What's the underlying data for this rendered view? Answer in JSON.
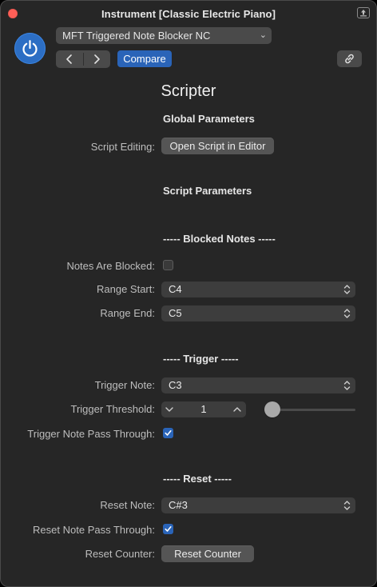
{
  "window": {
    "title": "Instrument [Classic Electric Piano]"
  },
  "header": {
    "preset": "MFT Triggered Note Blocker NC",
    "compare_label": "Compare"
  },
  "plugin": {
    "name": "Scripter"
  },
  "global": {
    "heading": "Global Parameters",
    "script_editing_label": "Script Editing:",
    "open_editor_label": "Open Script in Editor"
  },
  "script_params": {
    "heading": "Script Parameters"
  },
  "blocked": {
    "heading": "----- Blocked Notes -----",
    "notes_blocked_label": "Notes Are Blocked:",
    "notes_blocked_checked": false,
    "range_start_label": "Range Start:",
    "range_start_value": "C4",
    "range_end_label": "Range End:",
    "range_end_value": "C5"
  },
  "trigger": {
    "heading": "----- Trigger -----",
    "note_label": "Trigger Note:",
    "note_value": "C3",
    "threshold_label": "Trigger Threshold:",
    "threshold_value": "1",
    "threshold_slider_fraction": 0.0,
    "pass_through_label": "Trigger Note Pass Through:",
    "pass_through_checked": true
  },
  "reset": {
    "heading": "----- Reset -----",
    "note_label": "Reset Note:",
    "note_value": "C#3",
    "pass_through_label": "Reset Note Pass Through:",
    "pass_through_checked": true,
    "counter_label": "Reset Counter:",
    "counter_button_label": "Reset Counter"
  },
  "colors": {
    "accent": "#2a64b8",
    "window_bg": "#262626",
    "close": "#ff5f57"
  }
}
